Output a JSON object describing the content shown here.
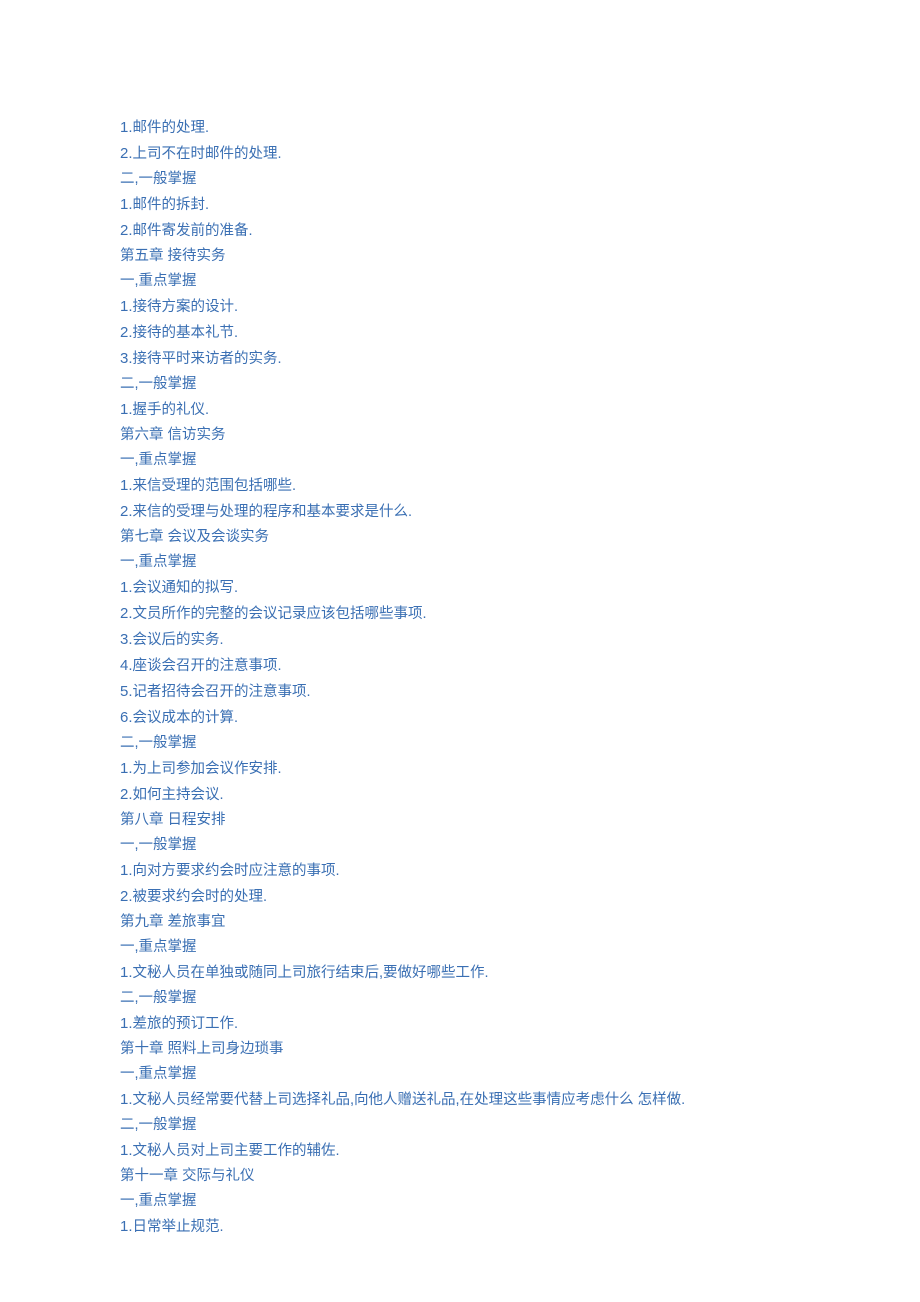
{
  "lines": [
    "1.邮件的处理.",
    "2.上司不在时邮件的处理.",
    "二,一般掌握",
    "1.邮件的拆封.",
    "2.邮件寄发前的准备.",
    "第五章 接待实务",
    "一,重点掌握",
    "1.接待方案的设计.",
    "2.接待的基本礼节.",
    "3.接待平时来访者的实务.",
    "二,一般掌握",
    "1.握手的礼仪.",
    "第六章 信访实务",
    "一,重点掌握",
    "1.来信受理的范围包括哪些.",
    "2.来信的受理与处理的程序和基本要求是什么.",
    "第七章 会议及会谈实务",
    "一,重点掌握",
    "1.会议通知的拟写.",
    "2.文员所作的完整的会议记录应该包括哪些事项.",
    "3.会议后的实务.",
    "4.座谈会召开的注意事项.",
    "5.记者招待会召开的注意事项.",
    "6.会议成本的计算.",
    "二,一般掌握",
    "1.为上司参加会议作安排.",
    "2.如何主持会议.",
    "第八章 日程安排",
    "一,一般掌握",
    "1.向对方要求约会时应注意的事项.",
    "2.被要求约会时的处理.",
    "第九章 差旅事宜",
    "一,重点掌握",
    "1.文秘人员在单独或随同上司旅行结束后,要做好哪些工作.",
    "二,一般掌握",
    "1.差旅的预订工作.",
    "第十章 照料上司身边琐事",
    "一,重点掌握",
    "1.文秘人员经常要代替上司选择礼品,向他人赠送礼品,在处理这些事情应考虑什么 怎样做.",
    "二,一般掌握",
    "1.文秘人员对上司主要工作的辅佐.",
    "第十一章 交际与礼仪",
    "一,重点掌握",
    "1.日常举止规范."
  ]
}
